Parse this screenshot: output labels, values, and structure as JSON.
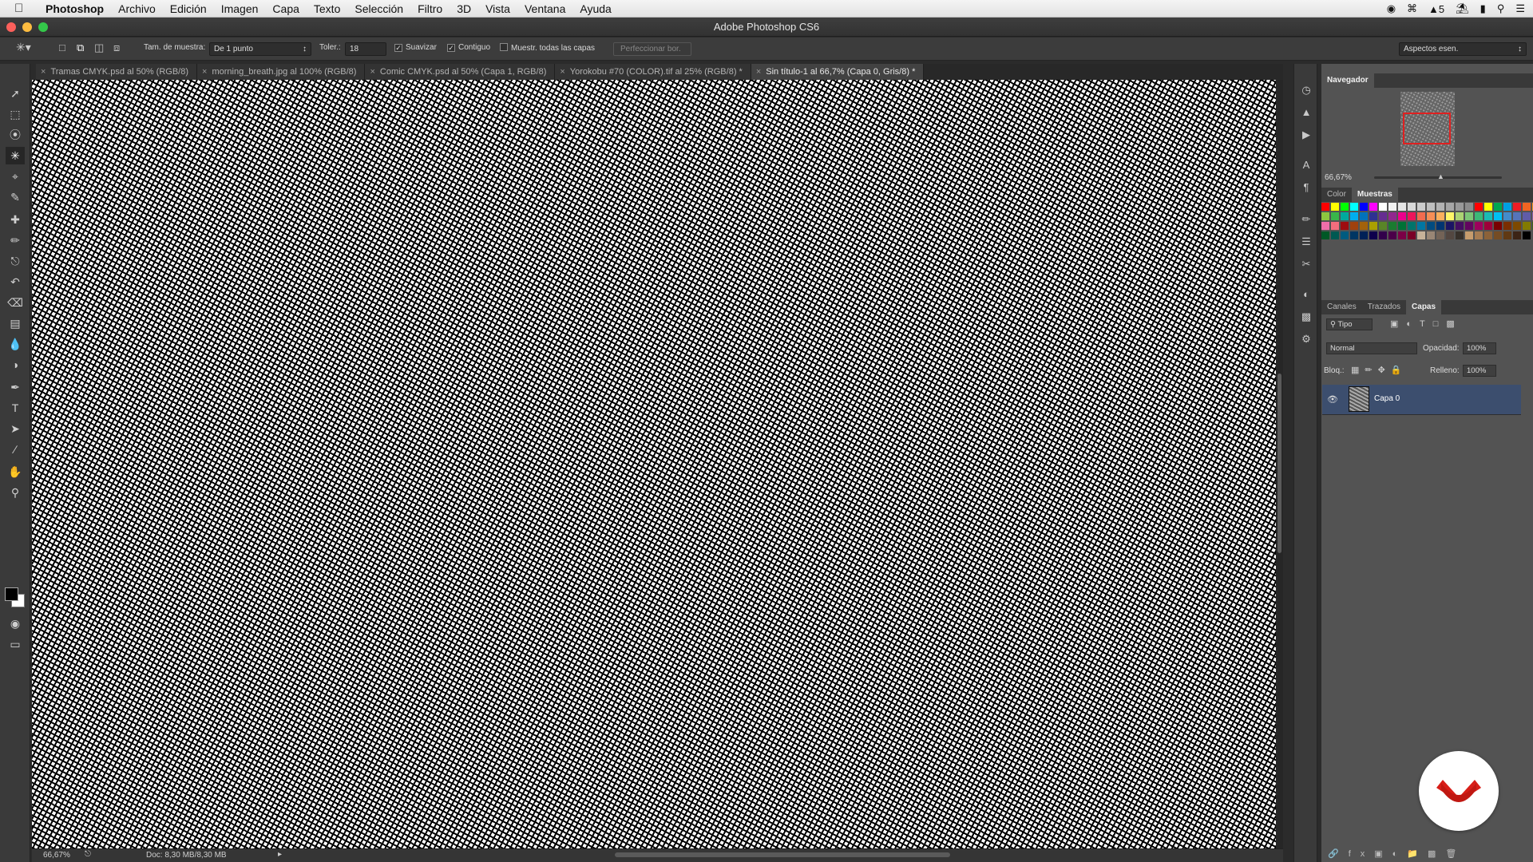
{
  "menubar": {
    "app": "Photoshop",
    "items": [
      "Archivo",
      "Edición",
      "Imagen",
      "Capa",
      "Texto",
      "Selección",
      "Filtro",
      "3D",
      "Vista",
      "Ventana",
      "Ayuda"
    ],
    "status_number": "5"
  },
  "window": {
    "title": "Adobe Photoshop CS6"
  },
  "options": {
    "sample_label": "Tam. de muestra:",
    "sample_value": "De 1 punto",
    "tolerance_label": "Toler.:",
    "tolerance_value": "18",
    "antialias_label": "Suavizar",
    "antialias_checked": true,
    "contiguous_label": "Contiguo",
    "contiguous_checked": true,
    "sample_all_label": "Muestr. todas las capas",
    "sample_all_checked": false,
    "refine_label": "Perfeccionar bor.",
    "workspace_value": "Aspectos esen."
  },
  "tabs": [
    {
      "label": "Tramas CMYK.psd al 50% (RGB/8)",
      "active": false
    },
    {
      "label": "morning_breath.jpg al 100% (RGB/8)",
      "active": false
    },
    {
      "label": "Comic CMYK.psd al 50% (Capa 1, RGB/8)",
      "active": false
    },
    {
      "label": "Yorokobu #70 (COLOR).tif al 25% (RGB/8) *",
      "active": false
    },
    {
      "label": "Sin título-1 al 66,7% (Capa 0, Gris/8) *",
      "active": true
    }
  ],
  "status": {
    "zoom": "66,67%",
    "doc": "Doc: 8,30 MB/8,30 MB"
  },
  "navigator": {
    "title": "Navegador",
    "zoom": "66,67%"
  },
  "color_panel": {
    "tabs": [
      "Color",
      "Muestras"
    ],
    "active": "Muestras"
  },
  "swatch_colors": [
    "#ff0000",
    "#ffff00",
    "#00ff00",
    "#00ffff",
    "#0000ff",
    "#ff00ff",
    "#ffffff",
    "#f2f2f2",
    "#e6e6e6",
    "#d9d9d9",
    "#cccccc",
    "#bfbfbf",
    "#b3b3b3",
    "#a6a6a6",
    "#999999",
    "#8c8c8c",
    "#ff0000",
    "#ffff00",
    "#00a651",
    "#00a0e3",
    "#ed1c24",
    "#f26522",
    "#f7941d",
    "#fff200",
    "#8dc63f",
    "#39b54a",
    "#00a99d",
    "#00aeef",
    "#0072bc",
    "#2e3192",
    "#662d91",
    "#92278f",
    "#ec008c",
    "#ed145b",
    "#f26c4f",
    "#f68e56",
    "#fbaf5d",
    "#fff568",
    "#acd373",
    "#7cc576",
    "#3bb878",
    "#1abbb4",
    "#00bff3",
    "#438ccb",
    "#5574b9",
    "#605ca8",
    "#8560a8",
    "#a864a8",
    "#f06eaa",
    "#f26d7d",
    "#9e0b0f",
    "#a0410d",
    "#a3620a",
    "#aba000",
    "#598527",
    "#1a7b30",
    "#007236",
    "#00746b",
    "#0076a3",
    "#004b80",
    "#003471",
    "#1b1464",
    "#440e62",
    "#630460",
    "#9e005d",
    "#9e0039",
    "#790000",
    "#7b2e00",
    "#7d4900",
    "#827b00",
    "#406618",
    "#005e20",
    "#005826",
    "#005952",
    "#005b7f",
    "#003663",
    "#002157",
    "#0d004c",
    "#32004b",
    "#4b0049",
    "#7b0046",
    "#7a0026",
    "#c7b299",
    "#998675",
    "#736357",
    "#534741",
    "#37302a",
    "#c69c6d",
    "#a67c52",
    "#8c6239",
    "#754c24",
    "#603913",
    "#3c2415",
    "#000000"
  ],
  "layers_panel": {
    "tabs": [
      "Canales",
      "Trazados",
      "Capas"
    ],
    "active": "Capas",
    "filter": "Tipo",
    "blend_mode": "Normal",
    "opacity_label": "Opacidad:",
    "opacity": "100%",
    "lock_label": "Bloq.:",
    "fill_label": "Relleno:",
    "fill": "100%",
    "layer_name": "Capa 0"
  }
}
